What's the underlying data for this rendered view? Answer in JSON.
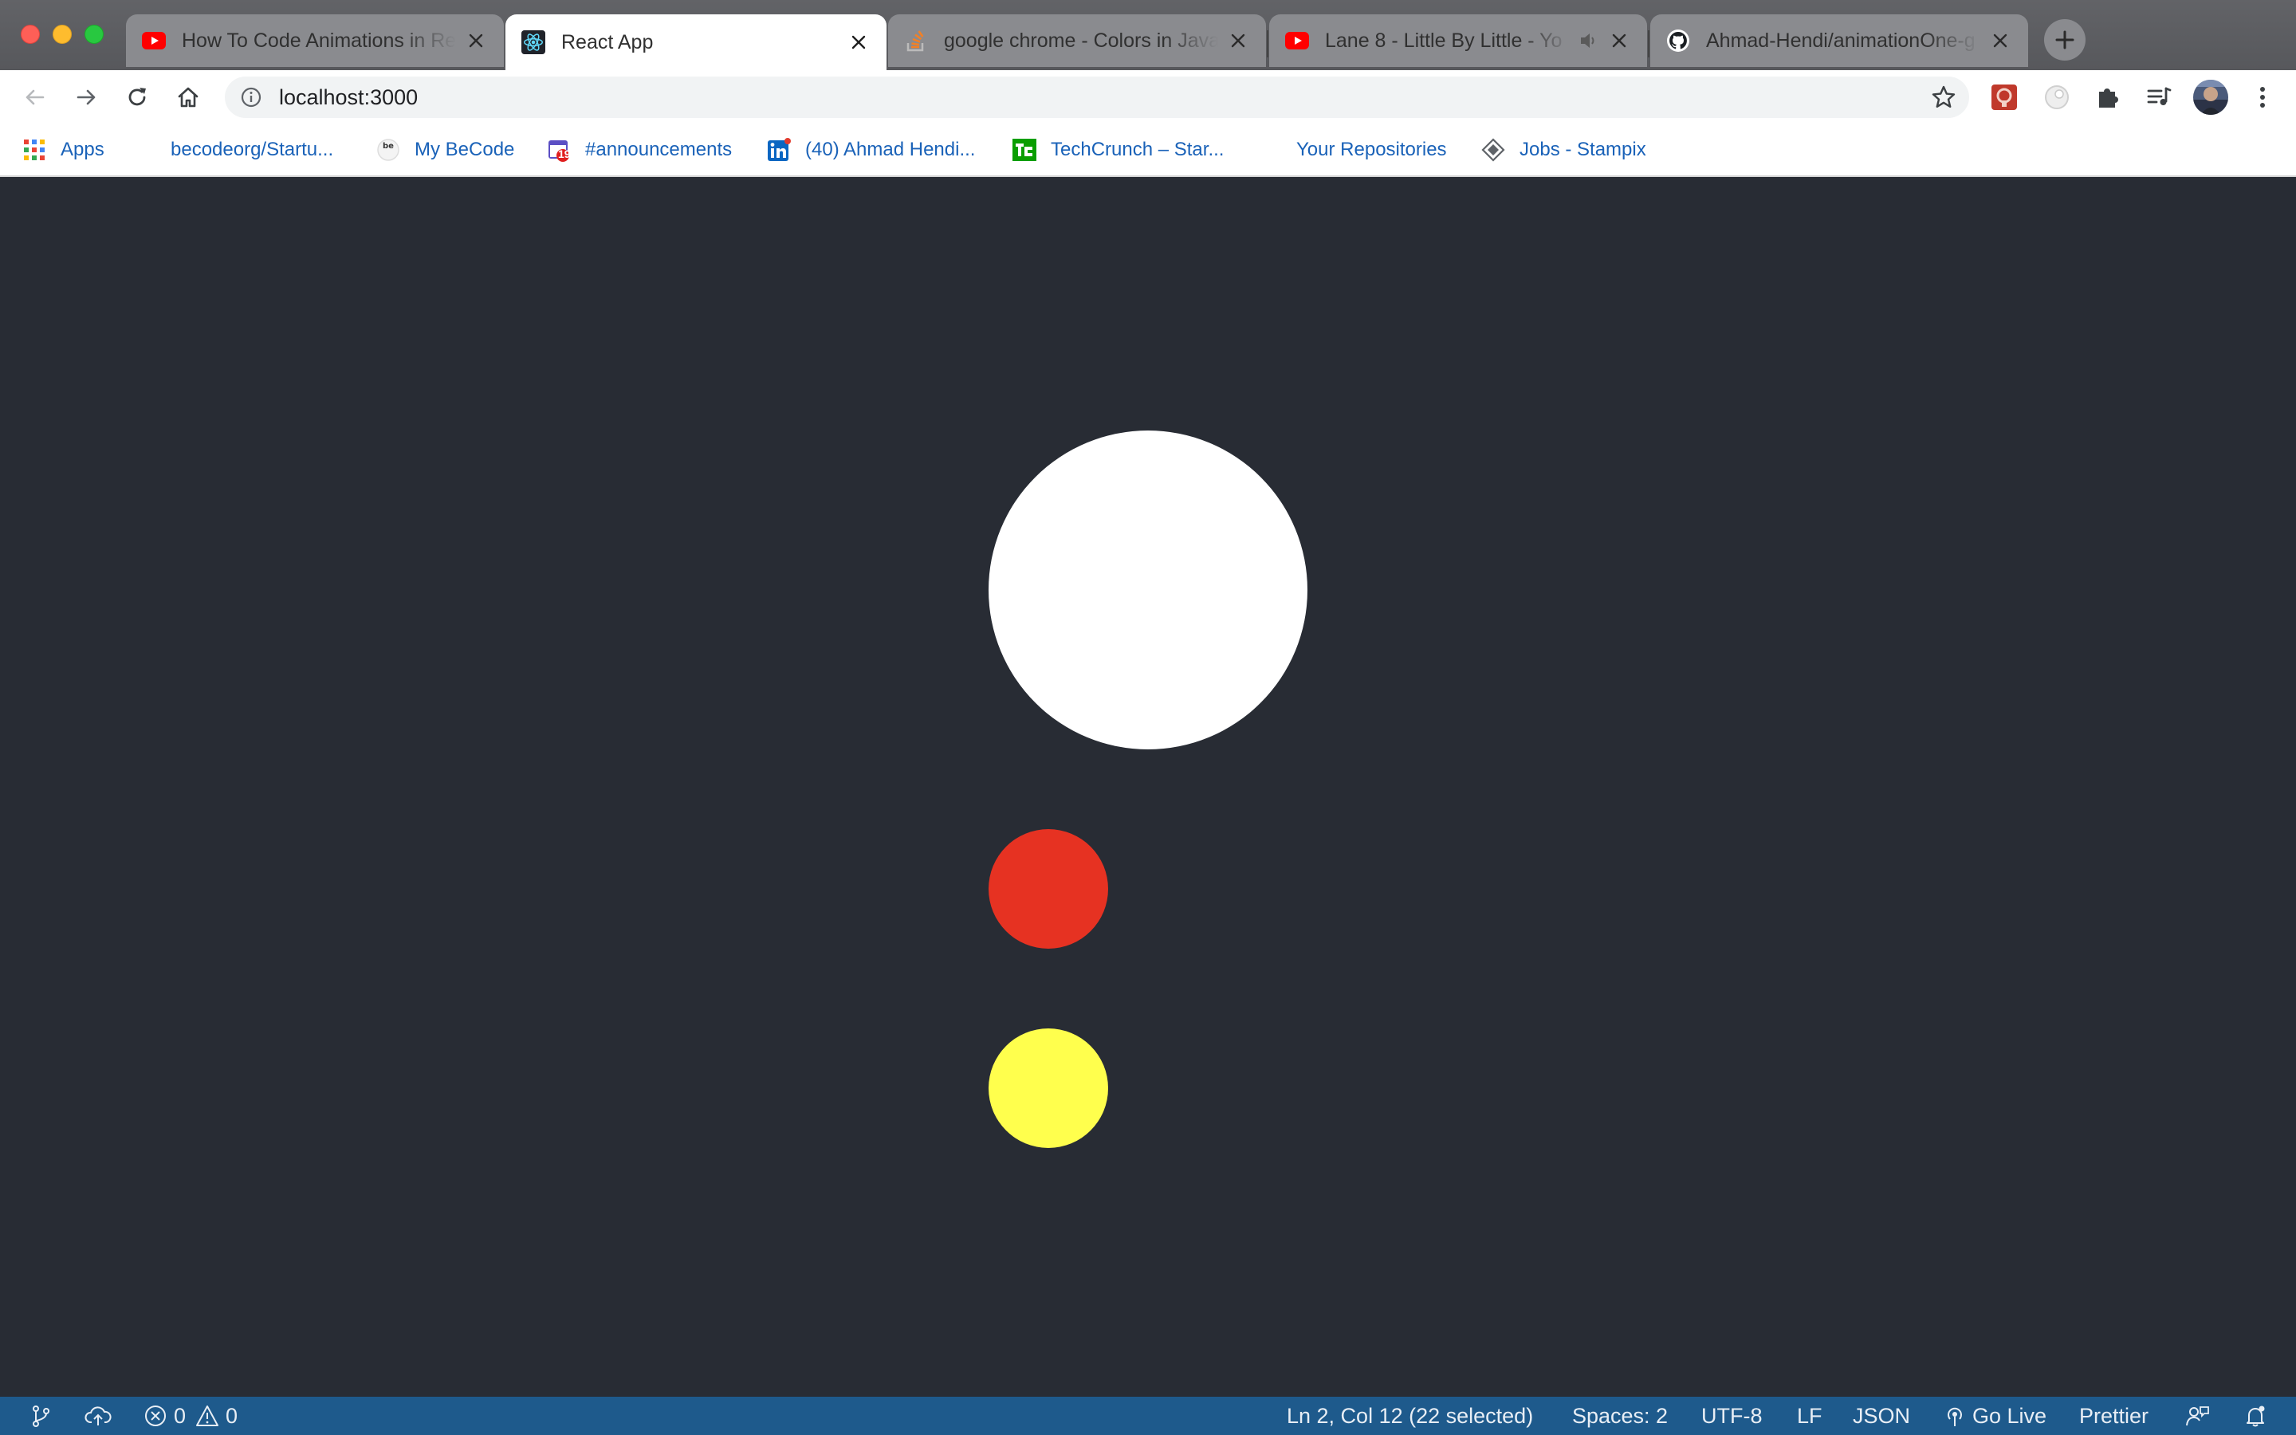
{
  "browser": {
    "tabs": [
      {
        "title": "How To Code Animations in Re",
        "favicon": "youtube-icon",
        "active": false
      },
      {
        "title": "React App",
        "favicon": "react-icon",
        "active": true
      },
      {
        "title": "google chrome - Colors in Java",
        "favicon": "stackoverflow-icon",
        "active": false
      },
      {
        "title": "Lane 8 - Little By Little - Yo",
        "favicon": "youtube-icon",
        "active": false,
        "audio": true
      },
      {
        "title": "Ahmad-Hendi/animationOne-g",
        "favicon": "github-icon",
        "active": false
      }
    ],
    "address": "localhost:3000",
    "bookmarks": [
      {
        "label": "Apps",
        "icon": "apps-grid-icon"
      },
      {
        "label": "becodeorg/Startu...",
        "icon": "globe-icon"
      },
      {
        "label": "My BeCode",
        "icon": "becode-icon"
      },
      {
        "label": "#announcements",
        "icon": "calendar-icon"
      },
      {
        "label": "(40) Ahmad Hendi...",
        "icon": "linkedin-icon"
      },
      {
        "label": "TechCrunch – Star...",
        "icon": "techcrunch-icon"
      },
      {
        "label": "Your Repositories",
        "icon": "globe-icon"
      },
      {
        "label": "Jobs - Stampix",
        "icon": "stampix-icon"
      }
    ],
    "bookmark_badge": "19"
  },
  "page": {
    "background": "#282c34",
    "circles": [
      {
        "name": "large-white-circle",
        "color": "#ffffff"
      },
      {
        "name": "red-circle",
        "color": "#e63222"
      },
      {
        "name": "yellow-circle",
        "color": "#ffff4d"
      }
    ]
  },
  "statusbar": {
    "errors": "0",
    "warnings": "0",
    "cursor": "Ln 2, Col 12 (22 selected)",
    "spaces": "Spaces: 2",
    "encoding": "UTF-8",
    "eol": "LF",
    "language": "JSON",
    "golive": "Go Live",
    "formatter": "Prettier",
    "color": "#1e5a8c"
  }
}
